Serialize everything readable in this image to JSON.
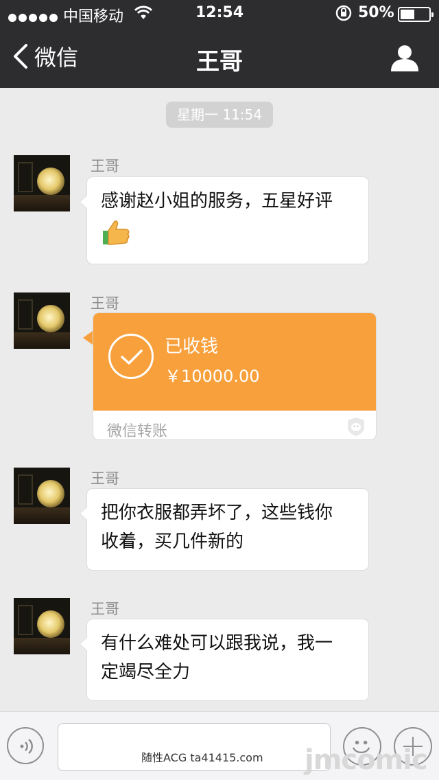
{
  "status_bar": {
    "carrier": "中国移动",
    "time": "12:54",
    "battery": "50%",
    "battery_level": 0.5
  },
  "nav": {
    "back_label": "微信",
    "title": "王哥"
  },
  "chat": {
    "timestamp": "星期一 11:54",
    "messages": [
      {
        "sender": "王哥",
        "lines": [
          "感谢赵小姐的服务，五星好评"
        ]
      },
      {
        "sender": "王哥",
        "transfer": {
          "status": "已收钱",
          "amount": "￥10000.00",
          "footer": "微信转账"
        }
      },
      {
        "sender": "王哥",
        "lines": [
          "把你衣服都弄坏了，这些钱你",
          "收着，买几件新的"
        ]
      },
      {
        "sender": "王哥",
        "lines": [
          "有什么难处可以跟我说，我一",
          "定竭尽全力"
        ]
      }
    ]
  },
  "watermarks": {
    "left": "随性ACG ta41415.com",
    "right": "jmcomic"
  },
  "colors": {
    "nav_bg": "#2d2d30",
    "chat_bg": "#ebebeb",
    "transfer_orange": "#f8a03c"
  },
  "icons": [
    "chevron-left-icon",
    "profile-icon",
    "check-circle-icon",
    "wechat-pay-shield-icon",
    "voice-icon",
    "emoji-icon",
    "plus-icon",
    "thumbs-up-icon",
    "wifi-icon",
    "lock-rotation-icon"
  ]
}
